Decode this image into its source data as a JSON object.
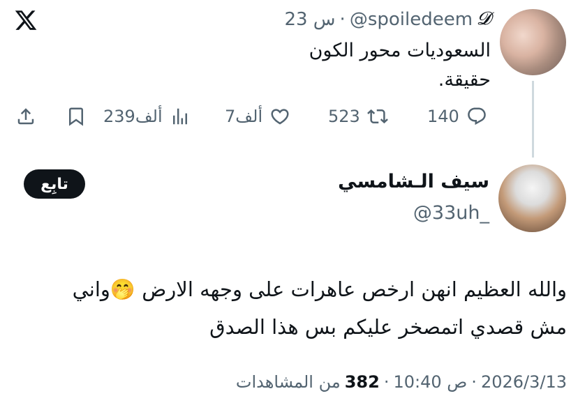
{
  "quoted_tweet": {
    "display_name": "𝓓",
    "handle": "@spoiledeem",
    "time_ago": "23 س",
    "separator": "·",
    "lines": [
      "السعوديات محور الكون",
      "حقيقة."
    ],
    "actions": {
      "replies": "140",
      "retweets": "523",
      "likes": "7ألف",
      "views": "239ألف"
    }
  },
  "reply_tweet": {
    "display_name": "سيف الـشامسي",
    "handle": "@33uh_",
    "follow_label": "تابِع",
    "lines": [
      "والله العظيم انهن ارخص عاهرات على وجهه الارض 🤭واني",
      "مش قصدي اتمصخر عليكم بس هذا الصدق"
    ],
    "date": "2026/3/13",
    "time": "10:40 ص",
    "views_count": "382",
    "views_label": "من المشاهدات",
    "sep": "·"
  },
  "icons": {
    "logo": "x-logo-icon",
    "reply": "reply-icon",
    "retweet": "retweet-icon",
    "like": "heart-icon",
    "views": "bar-chart-icon",
    "bookmark": "bookmark-icon",
    "share": "share-icon"
  }
}
